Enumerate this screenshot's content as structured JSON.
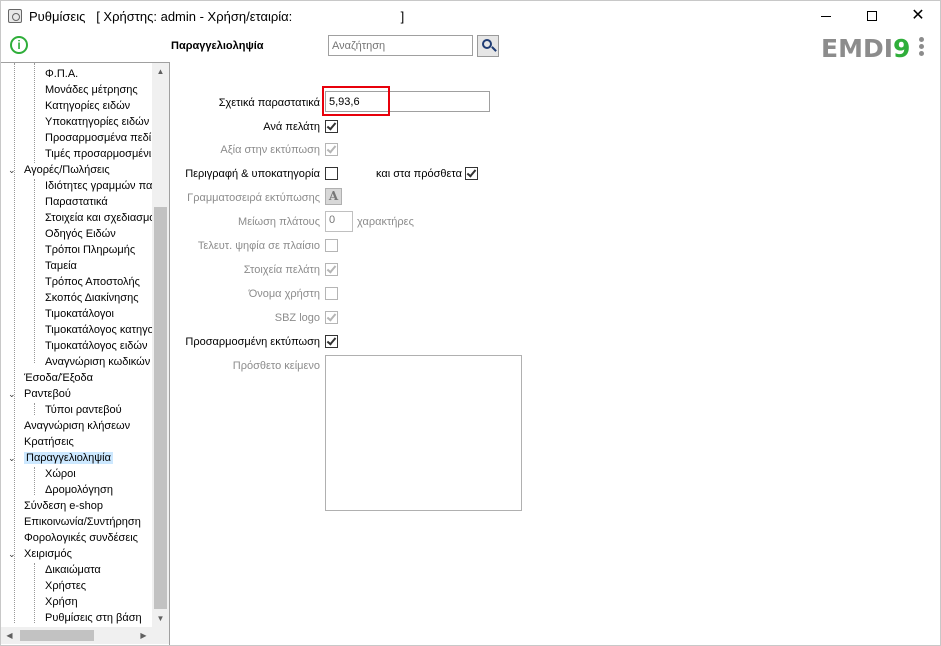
{
  "window": {
    "title": "Ρυθμίσεις   [ Χρήστης: admin - Χρήση/εταιρία:                              ]"
  },
  "toolbar": {
    "section_title": "Παραγγελιοληψία",
    "search_placeholder": "Αναζήτηση",
    "logo_part1": "EMDI",
    "logo_part2": "9"
  },
  "tree": {
    "items": [
      {
        "label": "Φ.Π.Α.",
        "level": 2
      },
      {
        "label": "Μονάδες μέτρησης",
        "level": 2
      },
      {
        "label": "Κατηγορίες ειδών",
        "level": 2
      },
      {
        "label": "Υποκατηγορίες ειδών",
        "level": 2
      },
      {
        "label": "Προσαρμοσμένα πεδί",
        "level": 2
      },
      {
        "label": "Τιμές προσαρμοσμένι",
        "level": 2
      },
      {
        "label": "Αγορές/Πωλήσεις",
        "level": 1,
        "expanded": true
      },
      {
        "label": "Ιδιότητες γραμμών πα",
        "level": 2
      },
      {
        "label": "Παραστατικά",
        "level": 2
      },
      {
        "label": "Στοιχεία και σχεδιασμό",
        "level": 2
      },
      {
        "label": "Οδηγός Ειδών",
        "level": 2
      },
      {
        "label": "Τρόποι Πληρωμής",
        "level": 2
      },
      {
        "label": "Ταμεία",
        "level": 2
      },
      {
        "label": "Τρόπος Αποστολής",
        "level": 2
      },
      {
        "label": "Σκοπός Διακίνησης",
        "level": 2
      },
      {
        "label": "Τιμοκατάλογοι",
        "level": 2
      },
      {
        "label": "Τιμοκατάλογος κατηγο",
        "level": 2
      },
      {
        "label": "Τιμοκατάλογος ειδών",
        "level": 2
      },
      {
        "label": "Αναγνώριση κωδικών",
        "level": 2
      },
      {
        "label": "Έσοδα/Έξοδα",
        "level": 1
      },
      {
        "label": "Ραντεβού",
        "level": 1,
        "expanded": true
      },
      {
        "label": "Τύποι ραντεβού",
        "level": 2
      },
      {
        "label": "Αναγνώριση κλήσεων",
        "level": 1
      },
      {
        "label": "Κρατήσεις",
        "level": 1
      },
      {
        "label": "Παραγγελιοληψία",
        "level": 1,
        "expanded": true,
        "selected": true
      },
      {
        "label": "Χώροι",
        "level": 2
      },
      {
        "label": "Δρομολόγηση",
        "level": 2
      },
      {
        "label": "Σύνδεση e-shop",
        "level": 1
      },
      {
        "label": "Επικοινωνία/Συντήρηση",
        "level": 1
      },
      {
        "label": "Φορολογικές συνδέσεις",
        "level": 1
      },
      {
        "label": "Χειρισμός",
        "level": 1,
        "expanded": true
      },
      {
        "label": "Δικαιώματα",
        "level": 2
      },
      {
        "label": "Χρήστες",
        "level": 2
      },
      {
        "label": "Χρήση",
        "level": 2
      },
      {
        "label": "Ρυθμίσεις στη βάση",
        "level": 2
      }
    ]
  },
  "form": {
    "documents_label": "Σχετικά παραστατικά",
    "documents_value": "5,93,6",
    "per_customer_label": "Ανά πελάτη",
    "per_customer_checked": true,
    "value_in_print_label": "Αξία στην εκτύπωση",
    "value_in_print_checked": true,
    "description_subcat_label": "Περιγραφή & υποκατηγορία",
    "description_subcat_checked": false,
    "also_extras_label": "και στα πρόσθετα",
    "also_extras_checked": true,
    "print_font_label": "Γραμματοσειρά εκτύπωσης",
    "print_font_button": "A",
    "width_reduction_label": "Μείωση πλάτους",
    "width_reduction_value": "0",
    "characters_label": "χαρακτήρες",
    "last_digits_label": "Τελευτ. ψηφία σε πλαίσιο",
    "last_digits_checked": false,
    "customer_info_label": "Στοιχεία πελάτη",
    "customer_info_checked": true,
    "username_label": "Όνομα χρήστη",
    "username_checked": false,
    "sbz_logo_label": "SBZ logo",
    "sbz_logo_checked": true,
    "custom_print_label": "Προσαρμοσμένη εκτύπωση",
    "custom_print_checked": true,
    "additional_text_label": "Πρόσθετο κείμενο",
    "additional_text_value": ""
  },
  "colors": {
    "accent_green": "#2fae3a",
    "highlight_red": "#e8000b",
    "selection": "#cce8ff"
  }
}
